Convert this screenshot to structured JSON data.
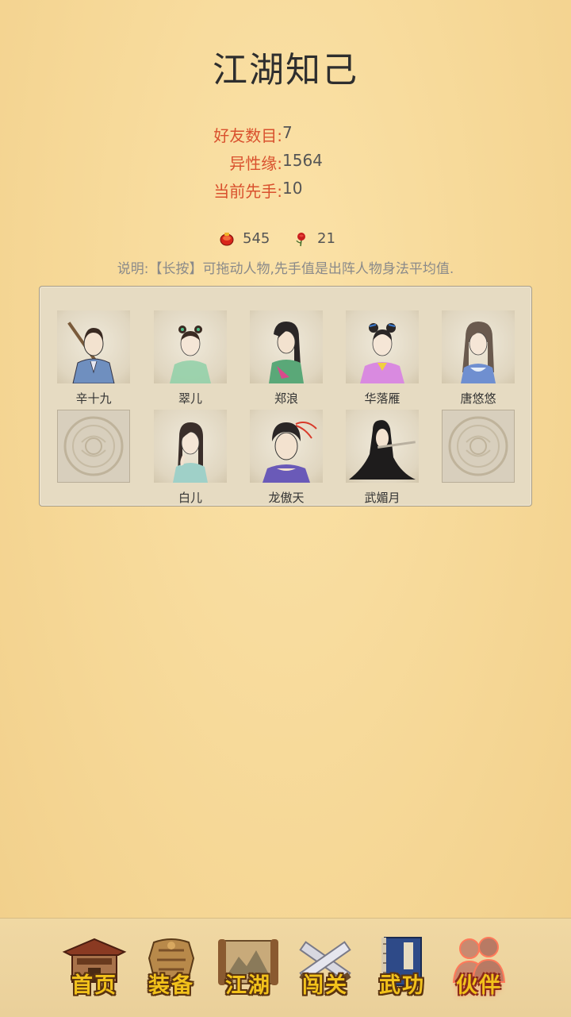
{
  "header": {
    "title": "江湖知己"
  },
  "stats": [
    {
      "label": "好友数目:",
      "value": "7"
    },
    {
      "label": "异性缘:",
      "value": "1564"
    },
    {
      "label": "当前先手:",
      "value": "10"
    }
  ],
  "currency": [
    {
      "icon": "red-coin-icon",
      "value": "545"
    },
    {
      "icon": "red-rose-icon",
      "value": "21"
    }
  ],
  "note": "说明:【长按】可拖动人物,先手值是出阵人物身法平均值.",
  "companions": [
    {
      "name": "辛十九",
      "empty": false
    },
    {
      "name": "翠儿",
      "empty": false
    },
    {
      "name": "郑浪",
      "empty": false
    },
    {
      "name": "华落雁",
      "empty": false
    },
    {
      "name": "唐悠悠",
      "empty": false
    },
    {
      "name": "",
      "empty": true
    },
    {
      "name": "白儿",
      "empty": false
    },
    {
      "name": "龙傲天",
      "empty": false
    },
    {
      "name": "武媚月",
      "empty": false
    },
    {
      "name": "",
      "empty": true
    }
  ],
  "nav": [
    {
      "label": "首页",
      "icon": "house-icon",
      "active": false
    },
    {
      "label": "装备",
      "icon": "armor-icon",
      "active": false
    },
    {
      "label": "江湖",
      "icon": "scroll-map-icon",
      "active": false
    },
    {
      "label": "闯关",
      "icon": "crossed-swords-icon",
      "active": false
    },
    {
      "label": "武功",
      "icon": "book-icon",
      "active": false
    },
    {
      "label": "伙伴",
      "icon": "companions-icon",
      "active": true
    }
  ],
  "colors": {
    "accent_label": "#d9512e",
    "nav_text": "#f2c21b",
    "background": "#f6d897"
  }
}
